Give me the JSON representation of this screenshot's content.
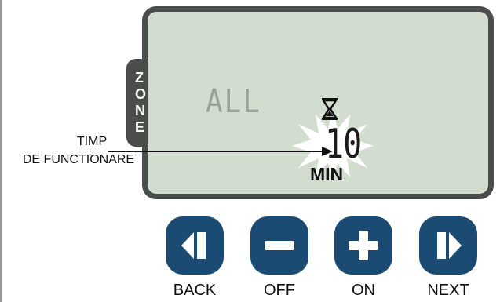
{
  "display": {
    "zone_tab_label": "ZONE",
    "zone_value": "ALL",
    "runtime_value": "10",
    "runtime_unit": "MIN",
    "hourglass_icon": "hourglass-icon",
    "highlight": "starburst-highlight"
  },
  "callout": {
    "line1": "TIMP",
    "line2": "DE FUNCTIONARE"
  },
  "buttons": [
    {
      "label": "BACK",
      "icon": "skip-back-icon"
    },
    {
      "label": "OFF",
      "icon": "minus-icon"
    },
    {
      "label": "ON",
      "icon": "plus-icon"
    },
    {
      "label": "NEXT",
      "icon": "skip-next-icon"
    }
  ],
  "colors": {
    "lcd_background": "#d3ddcf",
    "lcd_frame": "#4a4d4c",
    "button": "#1b4b72",
    "dim_segments": "#9aa49a"
  }
}
